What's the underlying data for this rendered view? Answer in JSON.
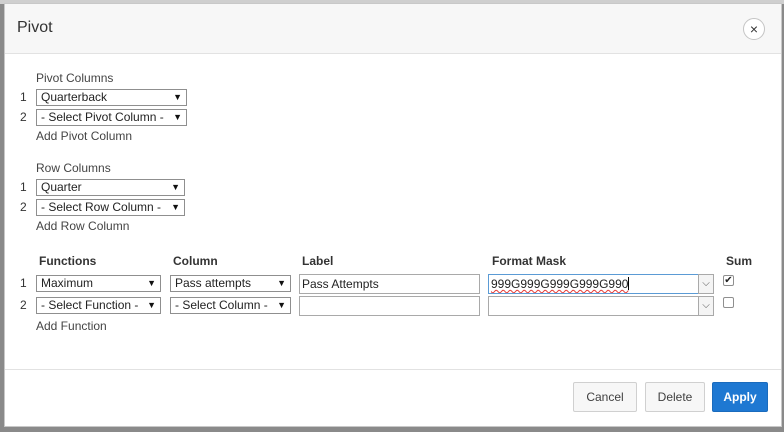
{
  "dialog": {
    "title": "Pivot",
    "close_label": "×"
  },
  "pivot": {
    "heading": "Pivot Columns",
    "rows": [
      {
        "num": "1",
        "value": "Quarterback"
      },
      {
        "num": "2",
        "value": "- Select Pivot Column -"
      }
    ],
    "add_label": "Add Pivot Column"
  },
  "row_columns": {
    "heading": "Row Columns",
    "rows": [
      {
        "num": "1",
        "value": "Quarter"
      },
      {
        "num": "2",
        "value": "- Select Row Column -"
      }
    ],
    "add_label": "Add Row Column"
  },
  "functions": {
    "headers": {
      "functions": "Functions",
      "column": "Column",
      "label": "Label",
      "format_mask": "Format Mask",
      "sum": "Sum"
    },
    "rows": [
      {
        "num": "1",
        "function": "Maximum",
        "column": "Pass attempts",
        "label": "Pass Attempts",
        "format_mask": "999G999G999G999G990",
        "sum_checked": true
      },
      {
        "num": "2",
        "function": "- Select Function -",
        "column": "- Select Column -",
        "label": "",
        "format_mask": "",
        "sum_checked": false
      }
    ],
    "add_label": "Add Function"
  },
  "footer": {
    "cancel": "Cancel",
    "delete": "Delete",
    "apply": "Apply"
  },
  "icons": {
    "dropdown_arrow": "▼",
    "mask_dropdown": "⌵",
    "checkmark": "✔"
  },
  "colors": {
    "accent": "#1e78d2",
    "focus_border": "#5b9bd5",
    "spell_underline": "#e53935"
  }
}
